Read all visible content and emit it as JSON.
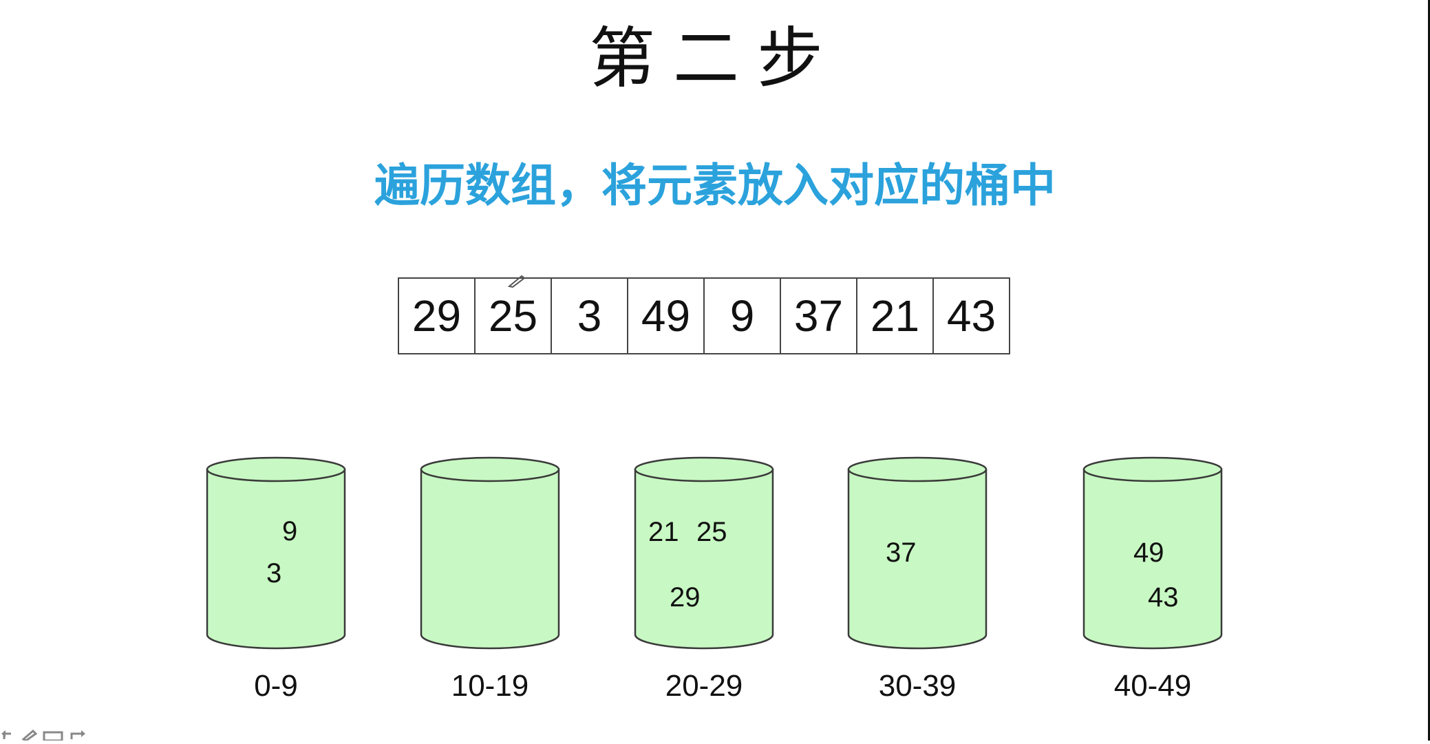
{
  "title": "第二步",
  "subtitle": "遍历数组，将元素放入对应的桶中",
  "array": [
    "29",
    "25",
    "3",
    "49",
    "9",
    "37",
    "21",
    "43"
  ],
  "buckets": [
    {
      "label": "0-9",
      "values": [
        "9",
        "3"
      ]
    },
    {
      "label": "10-19",
      "values": []
    },
    {
      "label": "20-29",
      "values": [
        "21",
        "25",
        "29"
      ]
    },
    {
      "label": "30-39",
      "values": [
        "37"
      ]
    },
    {
      "label": "40-49",
      "values": [
        "49",
        "43"
      ]
    }
  ],
  "colors": {
    "subtitle": "#2ba2dc",
    "bucket_fill": "#c8f8c3",
    "bucket_stroke": "#3a3a3a"
  },
  "icons": [
    "pen-cursor-icon",
    "undo-icon",
    "pen-icon",
    "eraser-icon",
    "redo-icon"
  ]
}
